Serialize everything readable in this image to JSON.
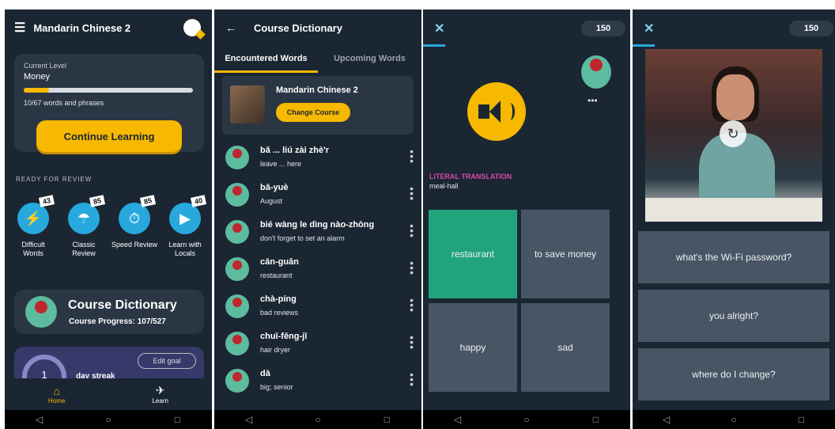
{
  "screen1": {
    "title": "Mandarin Chinese 2",
    "level": {
      "label": "Current Level",
      "name": "Money",
      "progress": 0.149,
      "count": "10/67 words and phrases"
    },
    "continue_label": "Continue Learning",
    "ready_label": "READY FOR REVIEW",
    "reviews": [
      {
        "label": "Difficult\nWords",
        "badge": "43",
        "icon": "lightning-icon"
      },
      {
        "label": "Classic\nReview",
        "badge": "85",
        "icon": "watering-can-icon"
      },
      {
        "label": "Speed Review",
        "badge": "85",
        "icon": "stopwatch-icon"
      },
      {
        "label": "Learn with\nLocals",
        "badge": "40",
        "icon": "video-camera-icon"
      }
    ],
    "dictionary": {
      "title": "Course Dictionary",
      "progress": "Course Progress: 107/527"
    },
    "streak": {
      "edit_label": "Edit goal",
      "value": "1",
      "label": "day streak"
    },
    "tabs": {
      "home": "Home",
      "learn": "Learn"
    }
  },
  "screen2": {
    "title": "Course Dictionary",
    "tabs": [
      "Encountered Words",
      "Upcoming Words"
    ],
    "course": {
      "name": "Mandarin Chinese 2",
      "button": "Change Course"
    },
    "words": [
      {
        "zh": "bǎ ... liú zài zhè'r",
        "en": "leave ... here"
      },
      {
        "zh": "bā-yuè",
        "en": "August"
      },
      {
        "zh": "bié wàng le dìng nào-zhōng",
        "en": "don't forget to set an alarm"
      },
      {
        "zh": "cān-guǎn",
        "en": "restaurant"
      },
      {
        "zh": "chà-píng",
        "en": "bad reviews"
      },
      {
        "zh": "chuī-fēng-jī",
        "en": "hair dryer"
      },
      {
        "zh": "dà",
        "en": "big; senior"
      }
    ]
  },
  "screen3": {
    "score": "150",
    "literal_title": "LITERAL TRANSLATION",
    "literal_value": "meal-hall",
    "options": [
      "restaurant",
      "to save money",
      "happy",
      "sad"
    ]
  },
  "screen4": {
    "score": "150",
    "answers": [
      "what's the Wi-Fi password?",
      "you alright?",
      "where do I change?"
    ]
  },
  "colors": {
    "accent": "#f6b800",
    "background": "#1b2633",
    "correct": "#21a47b",
    "option": "#485564"
  }
}
